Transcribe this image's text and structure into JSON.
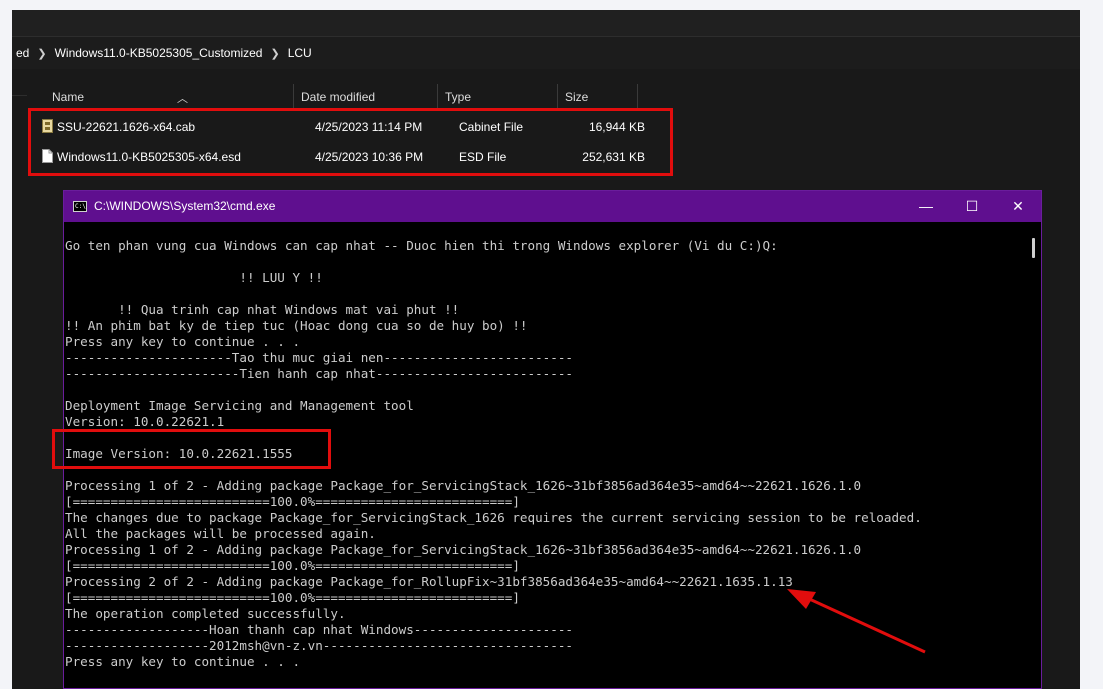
{
  "explorer": {
    "breadcrumb": [
      "ed",
      "Windows11.0-KB5025305_Customized",
      "LCU"
    ],
    "columns": {
      "name": "Name",
      "date": "Date modified",
      "type": "Type",
      "size": "Size"
    },
    "files": [
      {
        "name": "SSU-22621.1626-x64.cab",
        "date": "4/25/2023 11:14 PM",
        "type": "Cabinet File",
        "size": "16,944 KB",
        "icon": "cabinet-file-icon"
      },
      {
        "name": "Windows11.0-KB5025305-x64.esd",
        "date": "4/25/2023 10:36 PM",
        "type": "ESD File",
        "size": "252,631 KB",
        "icon": "document-file-icon"
      }
    ]
  },
  "cmd": {
    "title": "C:\\WINDOWS\\System32\\cmd.exe",
    "icon_text": "C:\\",
    "buttons": {
      "minimize": "—",
      "maximize": "☐",
      "close": "✕"
    },
    "lines": [
      "Go ten phan vung cua Windows can cap nhat -- Duoc hien thi trong Windows explorer (Vi du C:)Q:",
      "",
      "                       !! LUU Y !!",
      "",
      "       !! Qua trinh cap nhat Windows mat vai phut !!",
      "!! An phim bat ky de tiep tuc (Hoac dong cua so de huy bo) !!",
      "Press any key to continue . . .",
      "----------------------Tao thu muc giai nen-------------------------",
      "-----------------------Tien hanh cap nhat--------------------------",
      "",
      "Deployment Image Servicing and Management tool",
      "Version: 10.0.22621.1",
      "",
      "Image Version: 10.0.22621.1555",
      "",
      "Processing 1 of 2 - Adding package Package_for_ServicingStack_1626~31bf3856ad364e35~amd64~~22621.1626.1.0",
      "[==========================100.0%==========================]",
      "The changes due to package Package_for_ServicingStack_1626 requires the current servicing session to be reloaded.",
      "All the packages will be processed again.",
      "Processing 1 of 2 - Adding package Package_for_ServicingStack_1626~31bf3856ad364e35~amd64~~22621.1626.1.0",
      "[==========================100.0%==========================]",
      "Processing 2 of 2 - Adding package Package_for_RollupFix~31bf3856ad364e35~amd64~~22621.1635.1.13",
      "[==========================100.0%==========================]",
      "The operation completed successfully.",
      "-------------------Hoan thanh cap nhat Windows---------------------",
      "-------------------2012msh@vn-z.vn---------------------------------",
      "Press any key to continue . . ."
    ]
  },
  "colors": {
    "highlight_red": "#e10d0d",
    "cmd_titlebar": "#5f0f8f",
    "explorer_bg": "#191919"
  }
}
